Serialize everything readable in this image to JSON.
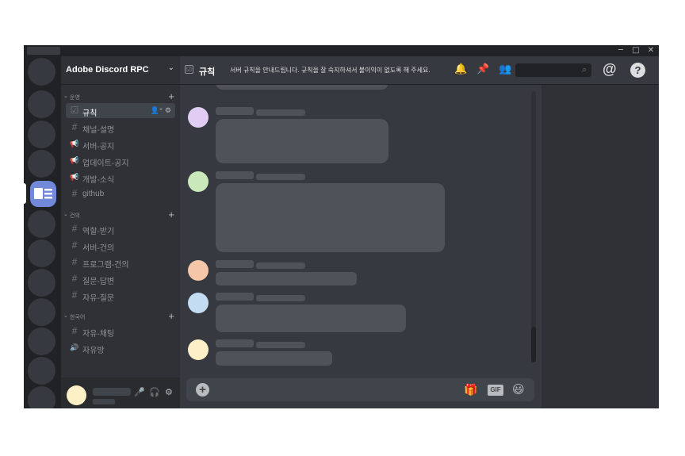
{
  "window": {
    "minimize_icon": "─",
    "maximize_icon": "□",
    "close_icon": "✕"
  },
  "server": {
    "name": "Adobe Discord RPC",
    "chevron": "⌄"
  },
  "categories": [
    {
      "name": "운영",
      "arrow": "⌄",
      "plus": "+"
    },
    {
      "name": "건의",
      "arrow": "⌄",
      "plus": "+"
    },
    {
      "name": "한국어",
      "arrow": "⌄",
      "plus": "+"
    }
  ],
  "channels": [
    {
      "name": "규칙",
      "icon": "rules-icon",
      "glyph": "☑",
      "active": true,
      "tools": "👤⁺ ⚙"
    },
    {
      "name": "채널-설명",
      "icon": "hash-icon",
      "glyph": "#"
    },
    {
      "name": "서버-공지",
      "icon": "megaphone-icon",
      "glyph": "📢"
    },
    {
      "name": "업데이트-공지",
      "icon": "megaphone-icon",
      "glyph": "📢"
    },
    {
      "name": "개발-소식",
      "icon": "megaphone-icon",
      "glyph": "📢"
    },
    {
      "name": "github",
      "icon": "hash-icon",
      "glyph": "#"
    },
    {
      "name": "역할-받기",
      "icon": "hash-icon",
      "glyph": "#"
    },
    {
      "name": "서버-건의",
      "icon": "hash-icon",
      "glyph": "#"
    },
    {
      "name": "프로그램-건의",
      "icon": "hash-icon",
      "glyph": "#"
    },
    {
      "name": "질문-답변",
      "icon": "hash-icon",
      "glyph": "#"
    },
    {
      "name": "자유-질문",
      "icon": "hash-icon",
      "glyph": "#"
    },
    {
      "name": "자유-채팅",
      "icon": "hash-icon",
      "glyph": "#"
    },
    {
      "name": "자유방",
      "icon": "speaker-icon",
      "glyph": "🔊"
    }
  ],
  "chat_header": {
    "channel_name": "규칙",
    "channel_icon": "☑",
    "topic": "서버 규칙을 안내드립니다. 규칙을 잘 숙지하셔서 불이익이 없도록 해 주세요.",
    "bell": "🔔",
    "pin": "📌",
    "members": "👥",
    "search_glyph": "⌕",
    "mention": "@",
    "help": "?"
  },
  "user_panel": {
    "mic": "🎤",
    "headset": "🎧",
    "settings": "⚙"
  },
  "composer": {
    "add": "+",
    "gift": "🎁",
    "gif": "GIF",
    "emoji": "😃"
  },
  "colors": {
    "accent": "#7289da",
    "avatars": [
      "#e1cdf3",
      "#c9e9bb",
      "#f6c6a9",
      "#c4dcf2",
      "#fdf0c6"
    ]
  }
}
